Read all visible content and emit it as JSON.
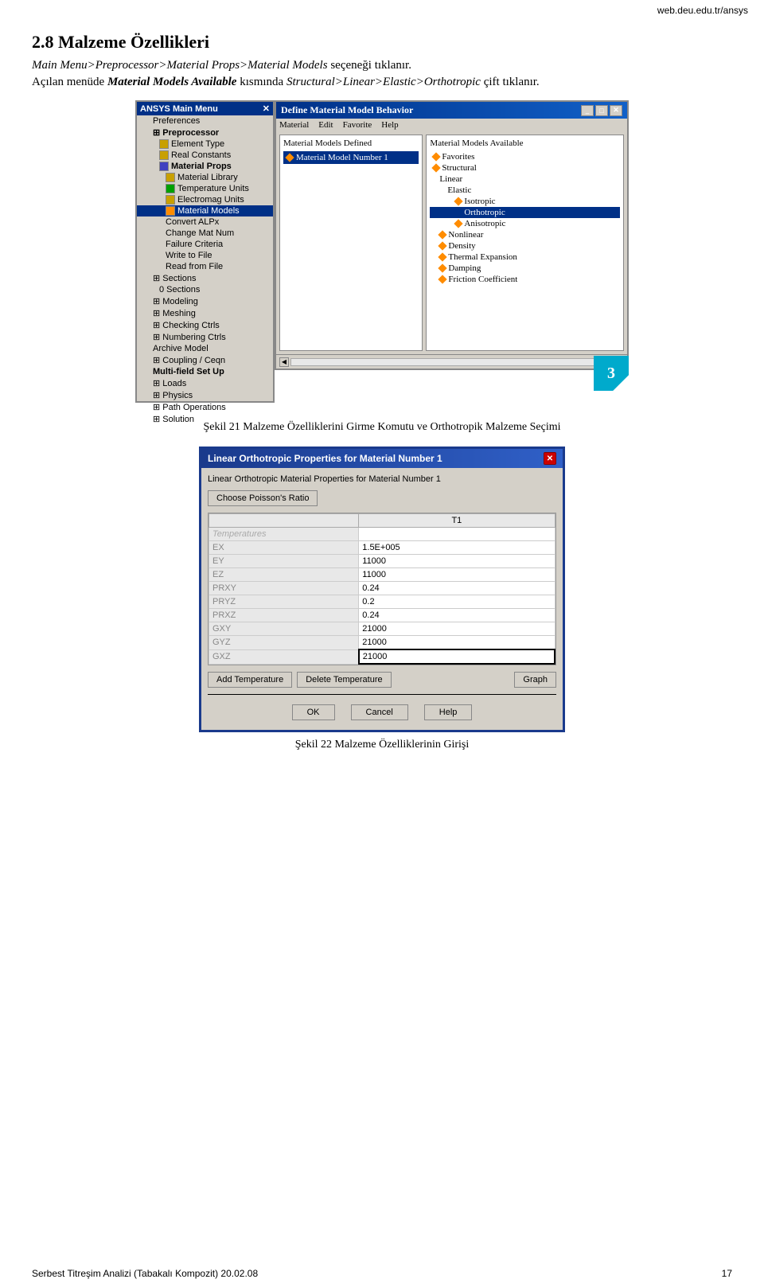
{
  "header": {
    "url": "web.deu.edu.tr/ansys"
  },
  "section": {
    "heading": "2.8 Malzeme Özellikleri",
    "line1": "Main Menu>Preprocessor>Material Props>Material Models seçeneği tıklanır.",
    "line1_parts": {
      "prefix": "",
      "italic": "Main Menu>Preprocessor>Material Props>Material Models",
      "suffix": " seçeneği tıklanır."
    },
    "line2_prefix": "Açılan menüde ",
    "line2_bold_italic": "Material Models Available",
    "line2_mid": " kısmında ",
    "line2_italic": "Structural>Linear>Elastic>Orthotropic",
    "line2_suffix": " çift tıklanır."
  },
  "ansys_menu": {
    "title": "ANSYS Main Menu",
    "items": [
      {
        "label": "Preferences",
        "indent": 1,
        "icon": false
      },
      {
        "label": "Preprocessor",
        "indent": 1,
        "icon": false,
        "bold": true
      },
      {
        "label": "Element Type",
        "indent": 2,
        "icon": true
      },
      {
        "label": "Real Constants",
        "indent": 2,
        "icon": true
      },
      {
        "label": "Material Props",
        "indent": 2,
        "icon": true,
        "bold": true
      },
      {
        "label": "Material Library",
        "indent": 3,
        "icon": true
      },
      {
        "label": "Temperature Units",
        "indent": 3,
        "icon": true
      },
      {
        "label": "Electromag Units",
        "indent": 3,
        "icon": true
      },
      {
        "label": "Material Models",
        "indent": 3,
        "icon": true,
        "highlighted": true
      },
      {
        "label": "Convert ALPx",
        "indent": 3,
        "icon": false
      },
      {
        "label": "Change Mat Num",
        "indent": 3,
        "icon": false
      },
      {
        "label": "Failure Criteria",
        "indent": 3,
        "icon": false
      },
      {
        "label": "Write to File",
        "indent": 3,
        "icon": false
      },
      {
        "label": "Read from File",
        "indent": 3,
        "icon": false
      },
      {
        "label": "Sections",
        "indent": 1,
        "icon": false
      },
      {
        "label": "0 Sections",
        "indent": 2,
        "icon": false
      },
      {
        "label": "Modeling",
        "indent": 1,
        "icon": false
      },
      {
        "label": "Meshing",
        "indent": 1,
        "icon": false
      },
      {
        "label": "Checking Ctrls",
        "indent": 1,
        "icon": false
      },
      {
        "label": "Numbering Ctrls",
        "indent": 1,
        "icon": false
      },
      {
        "label": "Archive Model",
        "indent": 1,
        "icon": false
      },
      {
        "label": "Coupling / Ceqn",
        "indent": 1,
        "icon": false
      },
      {
        "label": "Multi-field Set Up",
        "indent": 1,
        "icon": false
      },
      {
        "label": "Loads",
        "indent": 1,
        "icon": false
      },
      {
        "label": "Physics",
        "indent": 1,
        "icon": false
      },
      {
        "label": "Path Operations",
        "indent": 1,
        "icon": false
      },
      {
        "label": "Solution",
        "indent": 1,
        "icon": false
      }
    ]
  },
  "define_dialog": {
    "title": "Define Material Model Behavior",
    "menu": [
      "Material",
      "Edit",
      "Favorite",
      "Help"
    ],
    "left_panel_title": "Material Models Defined",
    "left_items": [
      "Material Model Number 1"
    ],
    "right_panel_title": "Material Models Available",
    "right_tree": [
      {
        "label": "Favorites",
        "indent": 0
      },
      {
        "label": "Structural",
        "indent": 0
      },
      {
        "label": "Linear",
        "indent": 1
      },
      {
        "label": "Elastic",
        "indent": 2
      },
      {
        "label": "Isotropic",
        "indent": 3
      },
      {
        "label": "Orthotropic",
        "indent": 3,
        "selected": true
      },
      {
        "label": "Anisotropic",
        "indent": 3
      },
      {
        "label": "Nonlinear",
        "indent": 1
      },
      {
        "label": "Density",
        "indent": 1
      },
      {
        "label": "Thermal Expansion",
        "indent": 1
      },
      {
        "label": "Damping",
        "indent": 1
      },
      {
        "label": "Friction Coefficient",
        "indent": 1
      }
    ],
    "number": "3"
  },
  "figure1_caption": "Şekil 21 Malzeme Özelliklerini Girme Komutu ve Orthotropik Malzeme Seçimi",
  "ortho_dialog": {
    "title": "Linear Orthotropic Properties for Material Number 1",
    "subtitle": "Linear Orthotropic Material Properties for Material Number 1",
    "poissons_btn": "Choose Poisson's Ratio",
    "column_header": "T1",
    "temp_label": "Temperatures",
    "rows": [
      {
        "label": "EX",
        "value": "1.5E+005"
      },
      {
        "label": "EY",
        "value": "11000"
      },
      {
        "label": "EZ",
        "value": "11000"
      },
      {
        "label": "PRXY",
        "value": "0.24"
      },
      {
        "label": "PRYZ",
        "value": "0.2"
      },
      {
        "label": "PRXZ",
        "value": "0.24"
      },
      {
        "label": "GXY",
        "value": "21000"
      },
      {
        "label": "GYZ",
        "value": "21000"
      },
      {
        "label": "GXZ",
        "value": "21000"
      }
    ],
    "add_temp_btn": "Add Temperature",
    "delete_temp_btn": "Delete Temperature",
    "graph_btn": "Graph",
    "ok_btn": "OK",
    "cancel_btn": "Cancel",
    "help_btn": "Help"
  },
  "figure2_caption": "Şekil 22 Malzeme Özelliklerinin Girişi",
  "footer": {
    "left": "Serbest Titreşim Analizi (Tabakalı Kompozit)  20.02.08",
    "right": "17"
  }
}
